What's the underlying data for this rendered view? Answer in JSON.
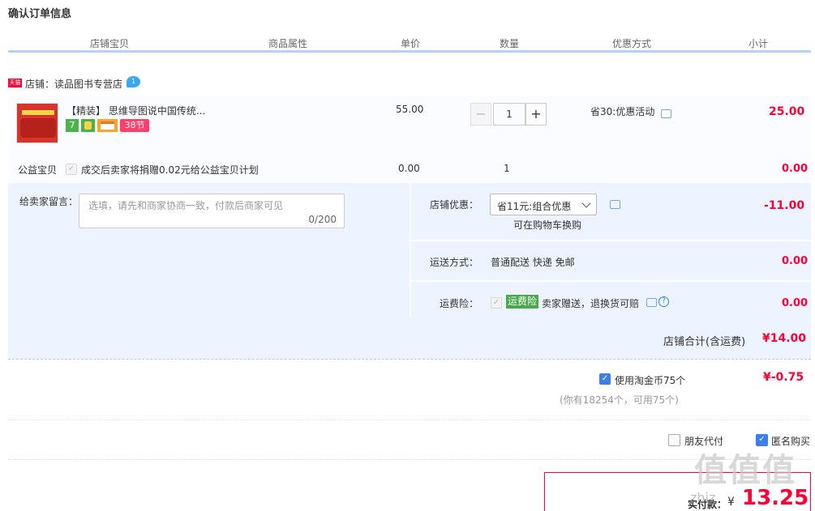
{
  "page_title": "确认订单信息",
  "columns": [
    "店铺宝贝",
    "商品属性",
    "单价",
    "数量",
    "优惠方式",
    "小计"
  ],
  "store": {
    "tag": "天猫",
    "label": "店铺：读品图书专营店",
    "wang": "1"
  },
  "item": {
    "name": "【精装】 思维导图说中国传统...",
    "badges": [
      "7",
      "",
      "",
      "38节"
    ],
    "price": "55.00",
    "quantity": "1",
    "promo": "省30:优惠活动",
    "subtotal": "25.00"
  },
  "charity": {
    "label": "公益宝贝",
    "text": "成交后卖家将捐赠0.02元给公益宝贝计划",
    "price": "0.00",
    "quantity": "1",
    "subtotal": "0.00"
  },
  "message": {
    "label": "给卖家留言：",
    "placeholder": "选填，请先和商家协商一致，付款后商家可见",
    "counter": "0/200"
  },
  "store_discount": {
    "label": "店铺优惠：",
    "selected": "省11元:组合优惠",
    "note": "可在购物车换购",
    "amount": "-11.00"
  },
  "shipping": {
    "label": "运送方式：",
    "value": "普通配送 快递 免邮",
    "amount": "0.00"
  },
  "insurance": {
    "label": "运费险：",
    "tag": "运费险",
    "text": "卖家赠送，退换货可赔",
    "amount": "0.00"
  },
  "store_total": {
    "label": "店铺合计(含运费)",
    "value": "¥14.00"
  },
  "coins": {
    "label": "使用淘金币75个",
    "note": "(你有18254个，可用75个)",
    "amount": "¥-0.75"
  },
  "options": {
    "friend_pay": "朋友代付",
    "anonymous": "匿名购买"
  },
  "payment": {
    "label": "实付款：",
    "currency": "¥",
    "value": "13.25"
  },
  "watermark": {
    "logo": "值",
    "site": "zhiz"
  },
  "colors": {
    "accent_red": "#ff0036",
    "header_line": "#b2d1ff",
    "panel_bg": "#eef4ff",
    "check_blue": "#3c7fe8"
  }
}
